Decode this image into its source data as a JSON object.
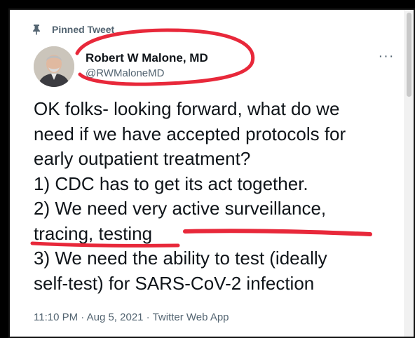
{
  "header": {
    "pinned_label": "Pinned Tweet"
  },
  "author": {
    "display_name": "Robert W Malone, MD",
    "handle": "@RWMaloneMD"
  },
  "more_label": "···",
  "tweet": {
    "lines": [
      "OK folks- looking forward, what do we",
      "need if we have accepted protocols for",
      "early outpatient treatment?",
      "1) CDC has to get its act together.",
      "2) We need very active surveillance,",
      "tracing, testing",
      "3) We need the ability to test (ideally",
      "self-test) for SARS-CoV-2 infection"
    ]
  },
  "meta": {
    "time": "11:10 PM",
    "sep1": " · ",
    "date": "Aug 5, 2021",
    "sep2": " · ",
    "source": "Twitter Web App"
  },
  "annotations": {
    "ink_color": "#e8283a"
  }
}
